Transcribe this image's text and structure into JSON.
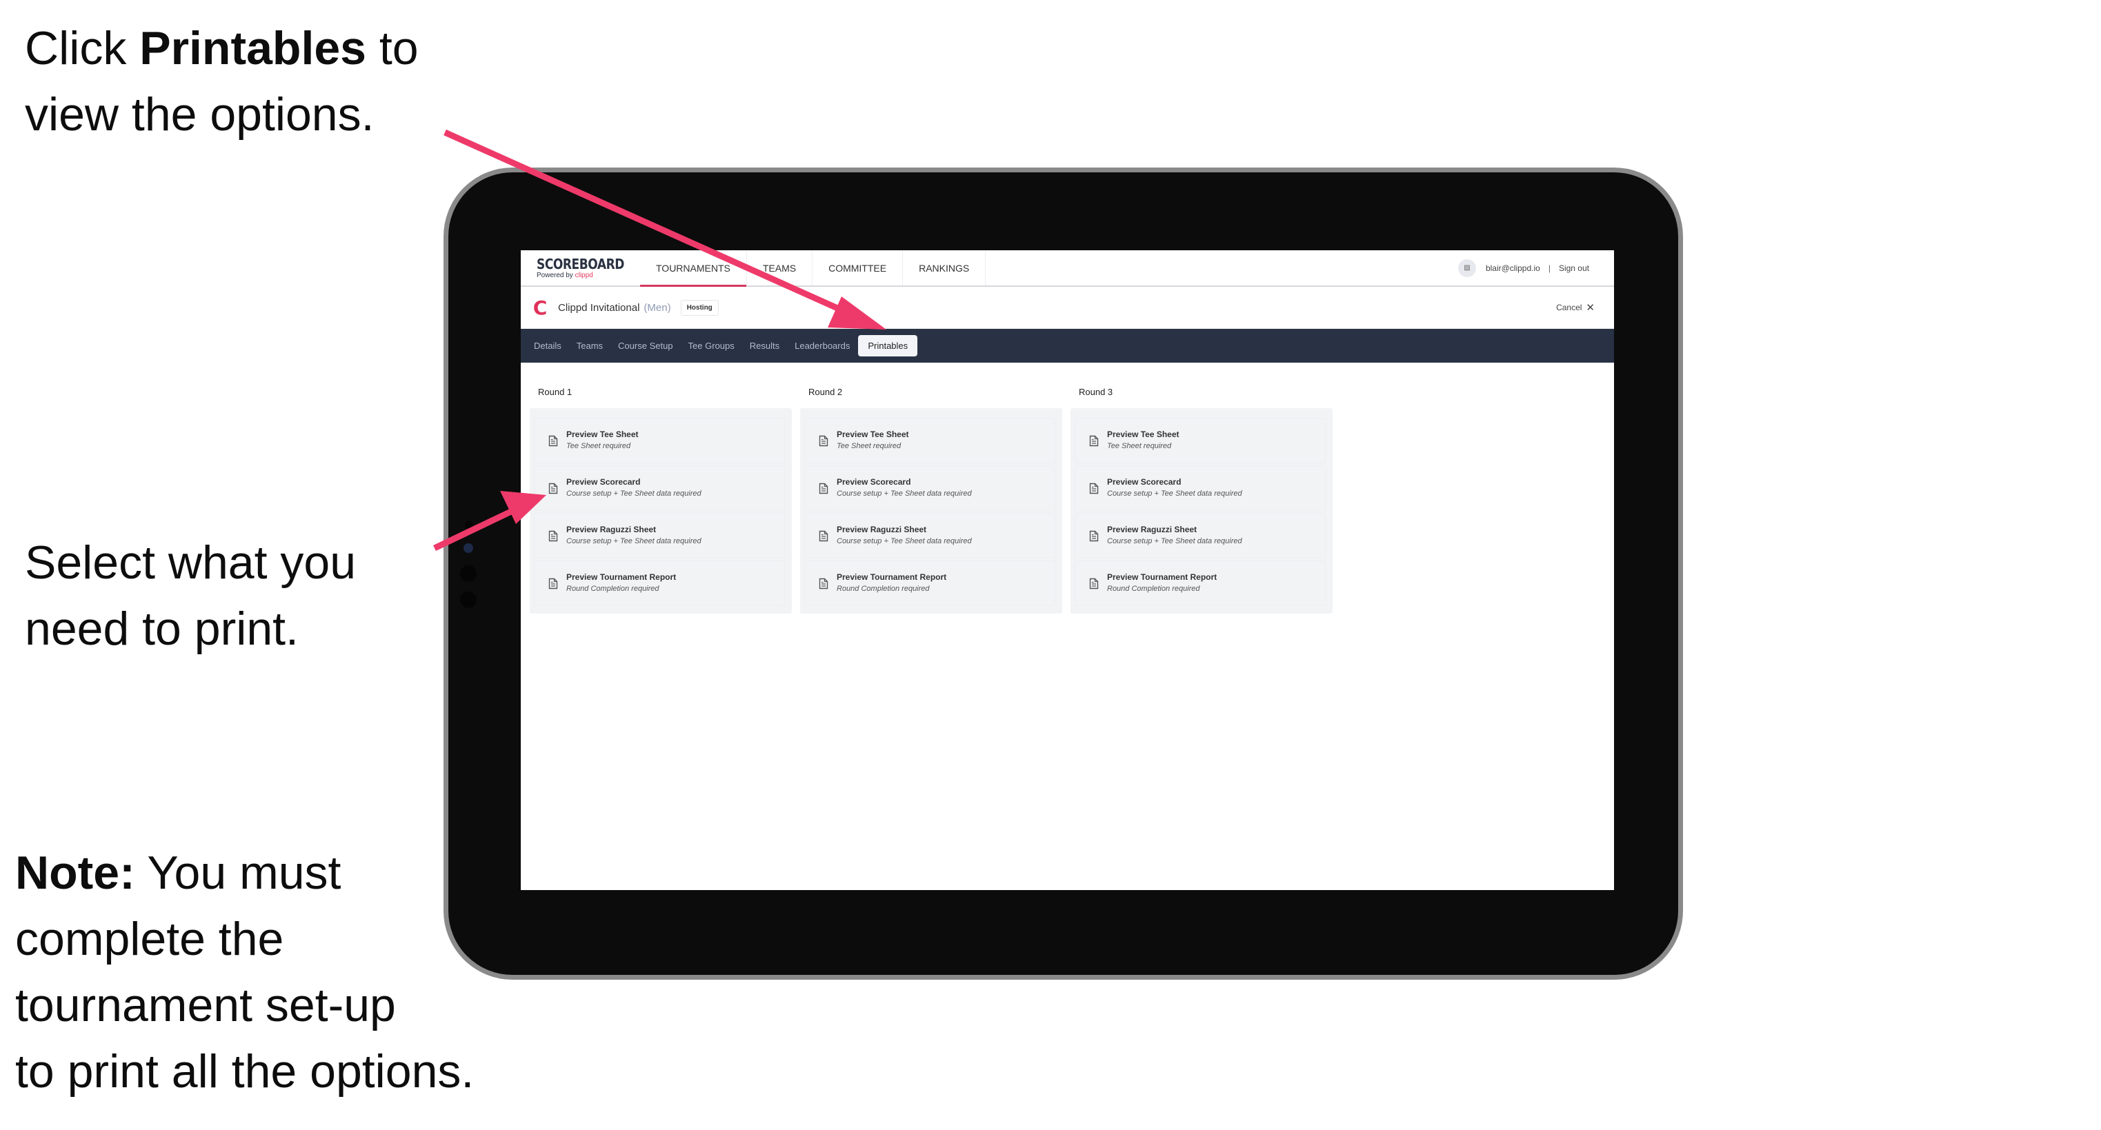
{
  "captions": {
    "top": {
      "pre": "Click ",
      "bold": "Printables",
      "post": " to",
      "line2": "view the options."
    },
    "middle": {
      "line1": "Select what you",
      "line2": "need to print."
    },
    "note": {
      "bold": "Note:",
      "line1": " You must",
      "line2": "complete the",
      "line3": "tournament set-up",
      "line4": "to print all the options."
    }
  },
  "app": {
    "logo": {
      "main": "SCOREBOARD",
      "sub_prefix": "Powered by ",
      "sub_brand": "clippd"
    },
    "nav": [
      {
        "label": "TOURNAMENTS",
        "active": true
      },
      {
        "label": "TEAMS",
        "active": false
      },
      {
        "label": "COMMITTEE",
        "active": false
      },
      {
        "label": "RANKINGS",
        "active": false
      }
    ],
    "user": {
      "avatar_icon": "image-placeholder-icon",
      "email": "blair@clippd.io",
      "separator": "|",
      "sign_out": "Sign out"
    }
  },
  "tournament": {
    "logo_letter": "C",
    "name": "Clippd Invitational",
    "gender": "(Men)",
    "badge": "Hosting",
    "cancel_label": "Cancel",
    "cancel_icon": "✕"
  },
  "tabs": [
    {
      "label": "Details",
      "active": false
    },
    {
      "label": "Teams",
      "active": false
    },
    {
      "label": "Course Setup",
      "active": false
    },
    {
      "label": "Tee Groups",
      "active": false
    },
    {
      "label": "Results",
      "active": false
    },
    {
      "label": "Leaderboards",
      "active": false
    },
    {
      "label": "Printables",
      "active": true
    }
  ],
  "rounds": [
    {
      "title": "Round 1",
      "items": [
        {
          "title": "Preview Tee Sheet",
          "subtitle": "Tee Sheet required"
        },
        {
          "title": "Preview Scorecard",
          "subtitle": "Course setup + Tee Sheet data required"
        },
        {
          "title": "Preview Raguzzi Sheet",
          "subtitle": "Course setup + Tee Sheet data required"
        },
        {
          "title": "Preview Tournament Report",
          "subtitle": "Round Completion required"
        }
      ]
    },
    {
      "title": "Round 2",
      "items": [
        {
          "title": "Preview Tee Sheet",
          "subtitle": "Tee Sheet required"
        },
        {
          "title": "Preview Scorecard",
          "subtitle": "Course setup + Tee Sheet data required"
        },
        {
          "title": "Preview Raguzzi Sheet",
          "subtitle": "Course setup + Tee Sheet data required"
        },
        {
          "title": "Preview Tournament Report",
          "subtitle": "Round Completion required"
        }
      ]
    },
    {
      "title": "Round 3",
      "items": [
        {
          "title": "Preview Tee Sheet",
          "subtitle": "Tee Sheet required"
        },
        {
          "title": "Preview Scorecard",
          "subtitle": "Course setup + Tee Sheet data required"
        },
        {
          "title": "Preview Raguzzi Sheet",
          "subtitle": "Course setup + Tee Sheet data required"
        },
        {
          "title": "Preview Tournament Report",
          "subtitle": "Round Completion required"
        }
      ]
    }
  ],
  "colors": {
    "accent": "#e23a5f",
    "tabs_bg": "#283244",
    "annotation_arrow": "#ee3a6a"
  }
}
